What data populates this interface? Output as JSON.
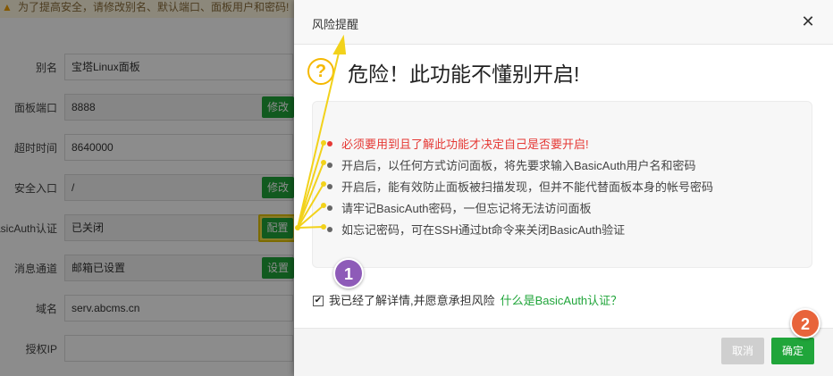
{
  "background": {
    "warning_text": "为了提高安全，请修改别名、默认端口、面板用户和密码!",
    "rows": [
      {
        "label": "别名",
        "value": "宝塔Linux面板"
      },
      {
        "label": "面板端口",
        "value": "8888",
        "button": "修改"
      },
      {
        "label": "超时时间",
        "value": "8640000"
      },
      {
        "label": "安全入口",
        "value": "/",
        "button": "修改"
      },
      {
        "label": "BasicAuth认证",
        "value": "已关闭",
        "button": "配置"
      },
      {
        "label": "消息通道",
        "value": "邮箱已设置",
        "button": "设置"
      },
      {
        "label": "域名",
        "value": "serv.abcms.cn"
      },
      {
        "label": "授权IP",
        "value": ""
      }
    ]
  },
  "dialog": {
    "title": "风险提醒",
    "close_icon": "close-icon",
    "warn_icon_glyph": "?",
    "heading": "危险！此功能不懂别开启!",
    "notices": [
      "必须要用到且了解此功能才决定自己是否要开启!",
      "开启后，以任何方式访问面板，将先要求输入BasicAuth用户名和密码",
      "开启后，能有效防止面板被扫描发现，但并不能代替面板本身的帐号密码",
      "请牢记BasicAuth密码，一但忘记将无法访问面板",
      "如忘记密码，可在SSH通过bt命令来关闭BasicAuth验证"
    ],
    "agree_checked": true,
    "agree_text": "我已经了解详情,并愿意承担风险",
    "agree_link": "什么是BasicAuth认证？",
    "cancel_label": "取消",
    "confirm_label": "确定"
  },
  "annotations": {
    "badge_1": "1",
    "badge_2": "2"
  },
  "colors": {
    "accent_green": "#20a53a",
    "danger_red": "#e53935",
    "warning_yellow": "#f5b800",
    "arrow_yellow": "#f2d21b",
    "badge_purple": "#8e5bb8",
    "badge_orange": "#e8643b"
  }
}
